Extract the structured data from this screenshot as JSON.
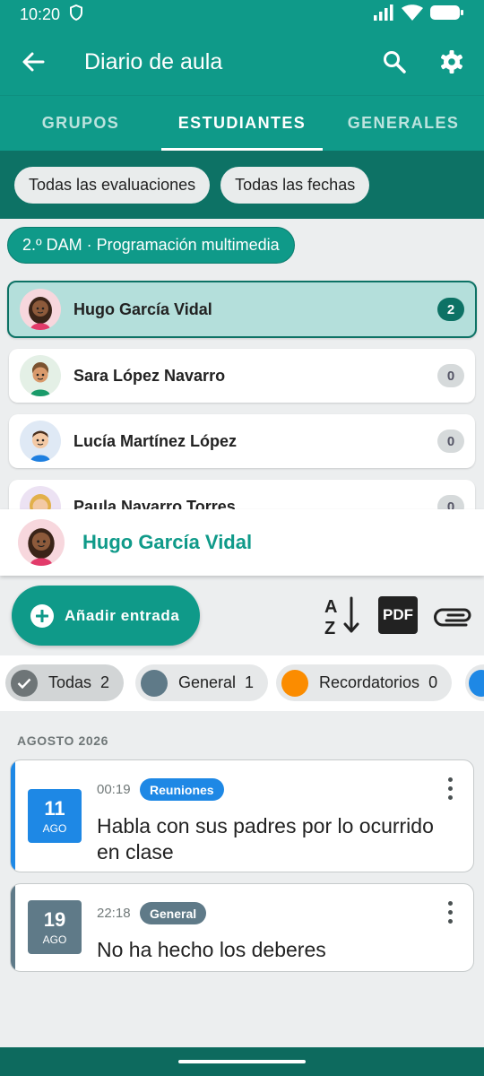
{
  "status_bar": {
    "time": "10:20"
  },
  "app_bar": {
    "title": "Diario de aula"
  },
  "tabs": [
    {
      "label": "GRUPOS",
      "active": false
    },
    {
      "label": "ESTUDIANTES",
      "active": true
    },
    {
      "label": "GENERALES",
      "active": false
    }
  ],
  "filters": {
    "evaluations": "Todas las evaluaciones",
    "dates": "Todas las fechas"
  },
  "group": "2.º DAM · Programación multimedia",
  "students": [
    {
      "name": "Hugo García Vidal",
      "count": "2",
      "selected": true
    },
    {
      "name": "Sara López Navarro",
      "count": "0",
      "selected": false
    },
    {
      "name": "Lucía Martínez López",
      "count": "0",
      "selected": false
    },
    {
      "name": "Paula Navarro Torres",
      "count": "0",
      "selected": false
    }
  ],
  "detail": {
    "student_name": "Hugo García Vidal"
  },
  "toolbar": {
    "add_label": "Añadir entrada",
    "pdf_label": "PDF"
  },
  "categories": [
    {
      "label": "Todas",
      "count": "2",
      "color": "#6e7577",
      "active": true
    },
    {
      "label": "General",
      "count": "1",
      "color": "#5f7a88",
      "active": false
    },
    {
      "label": "Recordatorios",
      "count": "0",
      "color": "#fb8c00",
      "active": false
    }
  ],
  "section": {
    "month": "AGOSTO 2026"
  },
  "entries": [
    {
      "day": "11",
      "month": "AGO",
      "time": "00:19",
      "tag": "Reuniones",
      "tag_color": "#1e88e5",
      "text": "Habla con sus padres por lo ocurrido en clase"
    },
    {
      "day": "19",
      "month": "AGO",
      "time": "22:18",
      "tag": "General",
      "tag_color": "#5f7a88",
      "text": "No ha hecho los deberes"
    }
  ],
  "colors": {
    "primary": "#0f9a89",
    "primary_dark": "#0d7265",
    "accent_blue": "#1e88e5",
    "accent_orange": "#fb8c00"
  }
}
